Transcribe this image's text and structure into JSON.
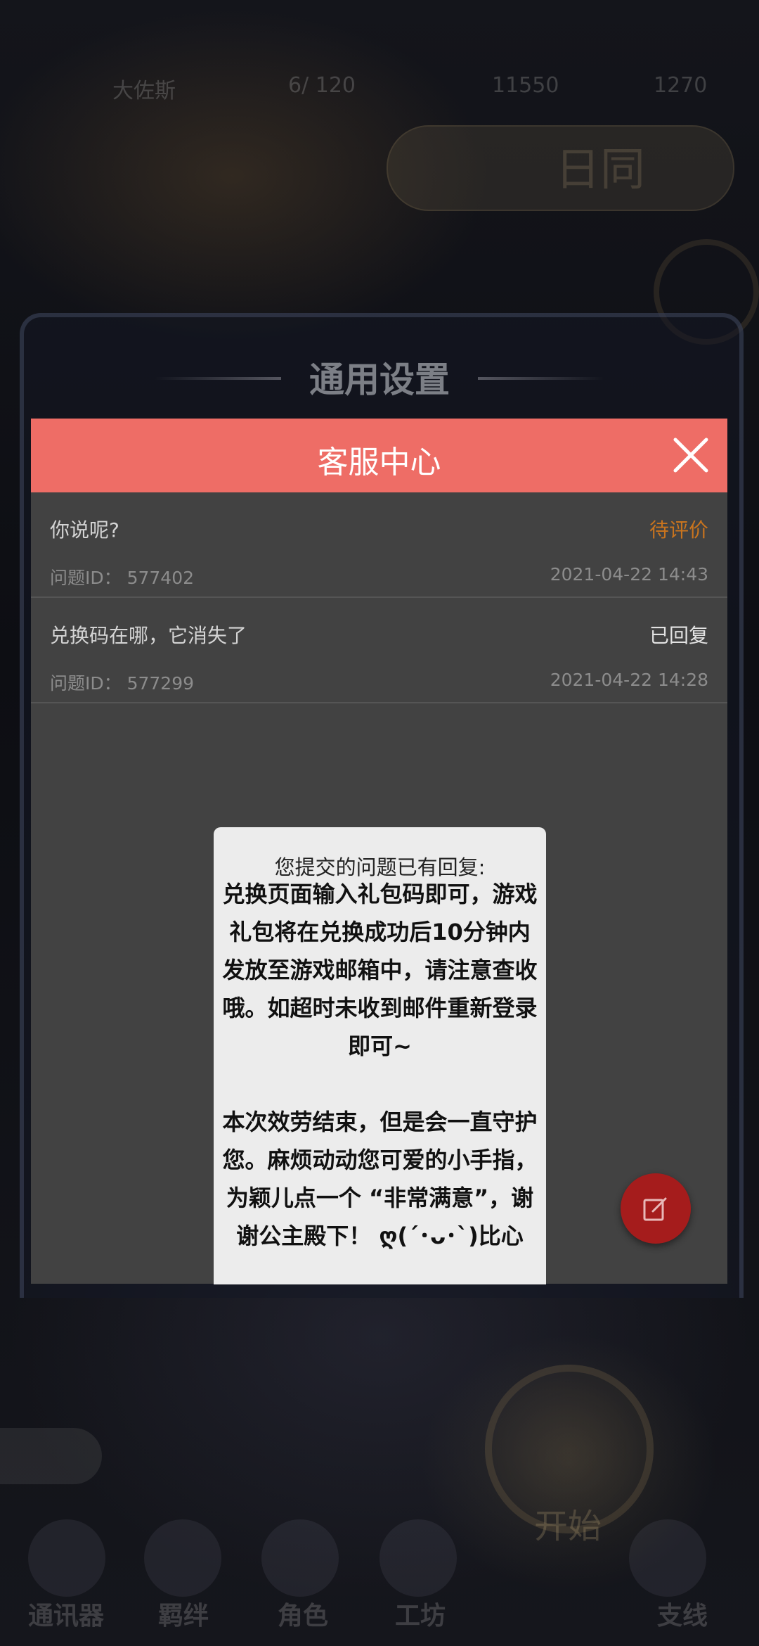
{
  "background": {
    "top_bar": {
      "name": "大佐斯",
      "stamina": "6/ 120",
      "gold": "11550",
      "gems": "1270"
    },
    "banner_text": "日同",
    "emblem_label": "开始",
    "bottom_nav": [
      "通讯器",
      "羁绊",
      "角色",
      "工坊",
      "支线"
    ]
  },
  "settings": {
    "title": "通用设置"
  },
  "panel": {
    "title": "客服中心",
    "header_color": "#ee6d66"
  },
  "tickets": [
    {
      "subject": "你说呢?",
      "status": "待评价",
      "status_color": "#c9741e",
      "id_label": "问题ID： 577402",
      "time": "2021-04-22 14:43"
    },
    {
      "subject": "兑换码在哪，它消失了",
      "status": "已回复",
      "status_color": "#e2e2e2",
      "id_label": "问题ID： 577299",
      "time": "2021-04-22 14:28"
    }
  ],
  "popup": {
    "heading": "您提交的问题已有回复:",
    "body": "兑换页面输入礼包码即可，游戏礼包将在兑换成功后10分钟内发放至游戏邮箱中，请注意查收哦。如超时未收到邮件重新登录即可~\n\n本次效劳结束，但是会一直守护您。麻烦动动您可爱的小手指，为颖儿点一个 “非常满意”，谢谢公主殿下！ ღ(´･ᴗ･`)比心"
  },
  "icons": {
    "close": "close-icon",
    "compose": "edit-icon"
  }
}
